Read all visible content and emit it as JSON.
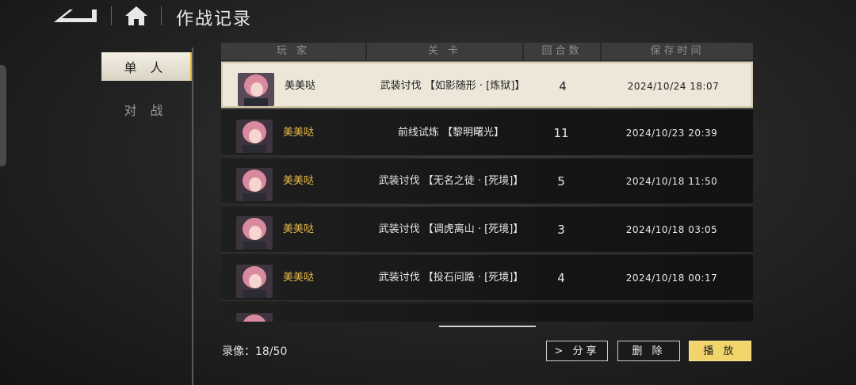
{
  "header": {
    "title": "作战记录"
  },
  "sidebar": {
    "tabs": [
      {
        "label": "单 人",
        "active": true
      },
      {
        "label": "对 战",
        "active": false
      }
    ]
  },
  "table": {
    "columns": [
      "玩 家",
      "关 卡",
      "回合数",
      "保存时间"
    ],
    "rows": [
      {
        "player": "美美哒",
        "stage": "武装讨伐 【如影随形 · [炼狱]】",
        "rounds": "4",
        "time": "2024/10/24 18:07",
        "selected": true
      },
      {
        "player": "美美哒",
        "stage": "前线试炼 【黎明曙光】",
        "rounds": "11",
        "time": "2024/10/23 20:39",
        "selected": false
      },
      {
        "player": "美美哒",
        "stage": "武装讨伐 【无名之徒 · [死境]】",
        "rounds": "5",
        "time": "2024/10/18 11:50",
        "selected": false
      },
      {
        "player": "美美哒",
        "stage": "武装讨伐 【调虎离山 · [死境]】",
        "rounds": "3",
        "time": "2024/10/18 03:05",
        "selected": false
      },
      {
        "player": "美美哒",
        "stage": "武装讨伐 【投石问路 · [死境]】",
        "rounds": "4",
        "time": "2024/10/18 00:17",
        "selected": false
      }
    ]
  },
  "footer": {
    "record_count": "录像：18/50"
  },
  "actions": {
    "share_label": "> 分享",
    "delete_label": "删 除",
    "play_label": "播 放"
  },
  "colors": {
    "accent_gold": "#e6b84a",
    "play_button": "#f1d46a",
    "selected_row": "#ede7da"
  }
}
